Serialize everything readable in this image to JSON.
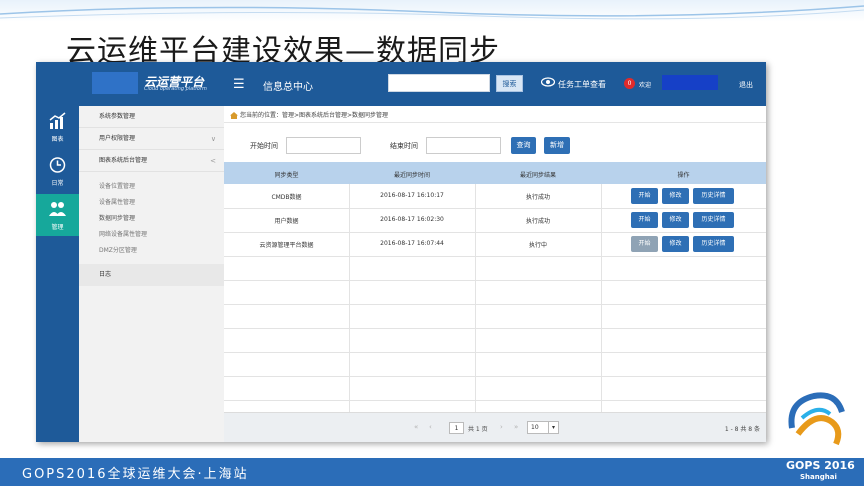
{
  "slide": {
    "title": "云运维平台建设效果—数据同步",
    "banner": "GOPS2016全球运维大会·上海站",
    "event_logo": {
      "name": "GOPS 2016",
      "city": "Shanghai"
    }
  },
  "app": {
    "logo_text": "云运营平台",
    "logo_sub": "Cloud operating platform",
    "module_title": "信息总中心",
    "search_button": "搜索",
    "task_link": "任务工单查看",
    "notification_count": "0",
    "welcome_label": "欢迎",
    "logout": "退出"
  },
  "iconbar": [
    {
      "label": "图表",
      "icon": "chart-icon"
    },
    {
      "label": "日常",
      "icon": "clock-icon"
    },
    {
      "label": "管理",
      "icon": "users-icon",
      "active": true
    }
  ],
  "tree": {
    "items": [
      {
        "label": "系统参数管理"
      },
      {
        "label": "用户权限管理",
        "arrow": "∨"
      },
      {
        "label": "图表系统后台管理",
        "arrow": "<"
      }
    ],
    "sub_items": [
      "设备位置管理",
      "设备属性管理",
      "数据同步管理",
      "网络设备属性管理",
      "DMZ分区管理"
    ],
    "log": "日志"
  },
  "breadcrumb": "您当前的位置：管理>图表系统后台管理>数据同步管理",
  "filters": {
    "start_label": "开始时间",
    "end_label": "结束时间",
    "query_button": "查询",
    "add_button": "新增"
  },
  "table": {
    "headers": [
      "同步类型",
      "最近同步时间",
      "最近同步结果",
      "操作"
    ],
    "rows": [
      {
        "type": "CMDB数据",
        "time": "2016-08-17 16:10:17",
        "result": "执行成功",
        "start_disabled": false
      },
      {
        "type": "用户数据",
        "time": "2016-08-17 16:02:30",
        "result": "执行成功",
        "start_disabled": false
      },
      {
        "type": "云资源管理平台数据",
        "time": "2016-08-17 16:07:44",
        "result": "执行中",
        "start_disabled": true
      }
    ],
    "actions": {
      "start": "开始",
      "edit": "修改",
      "history": "历史详情"
    }
  },
  "pager": {
    "first": "«",
    "prev": "‹",
    "current_page": "1",
    "total_pages": "共 1 页",
    "next": "›",
    "last": "»",
    "page_size": "10",
    "range": "1 - 8  共 8 条"
  }
}
